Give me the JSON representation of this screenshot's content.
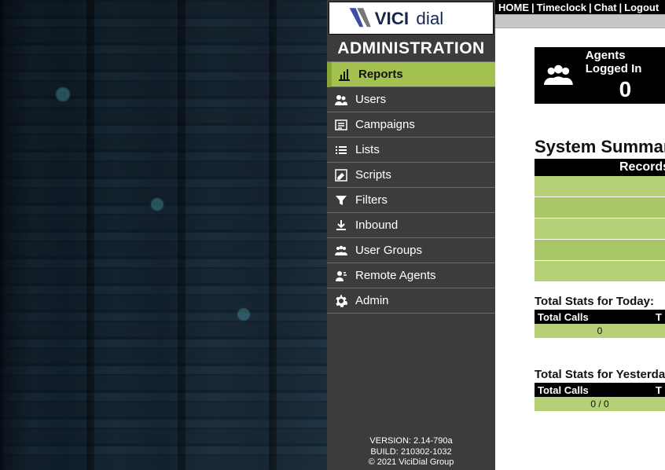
{
  "topnav": {
    "home": "HOME",
    "timeclock": "Timeclock",
    "chat": "Chat",
    "logout": "Logout"
  },
  "sidebar": {
    "title": "ADMINISTRATION",
    "items": [
      {
        "label": "Reports",
        "icon": "bar-chart-icon",
        "active": true
      },
      {
        "label": "Users",
        "icon": "users-icon"
      },
      {
        "label": "Campaigns",
        "icon": "list-box-icon"
      },
      {
        "label": "Lists",
        "icon": "list-icon"
      },
      {
        "label": "Scripts",
        "icon": "pencil-square-icon"
      },
      {
        "label": "Filters",
        "icon": "funnel-icon"
      },
      {
        "label": "Inbound",
        "icon": "download-icon"
      },
      {
        "label": "User Groups",
        "icon": "group-icon"
      },
      {
        "label": "Remote Agents",
        "icon": "remote-user-icon"
      },
      {
        "label": "Admin",
        "icon": "gear-icon"
      }
    ],
    "footer": {
      "version": "VERSION: 2.14-790a",
      "build": "BUILD: 210302-1032",
      "copyright": "© 2021 ViciDial Group"
    }
  },
  "agents_card": {
    "label": "Agents Logged In",
    "value": "0"
  },
  "summary": {
    "title": "System Summary",
    "head_col": "Records"
  },
  "stats_today": {
    "title": "Total Stats for Today:",
    "head_left": "Total Calls",
    "head_right": "T",
    "value": "0"
  },
  "stats_yesterday": {
    "title": "Total Stats for Yesterday:",
    "head_left": "Total Calls",
    "head_right": "T",
    "value": "0 / 0"
  }
}
